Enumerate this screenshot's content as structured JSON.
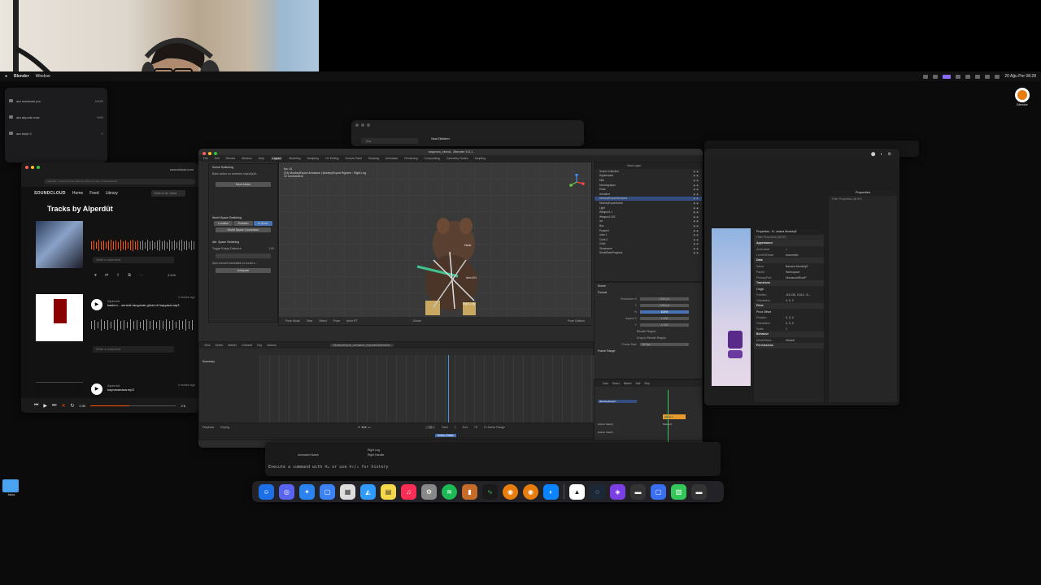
{
  "menubar": {
    "app": "Blender",
    "items": [
      "Window"
    ],
    "clock": "20 Ağu Per 08:28"
  },
  "bluetooth": {
    "devices": [
      {
        "name": "ara macbook pro",
        "status": "N/OR"
      },
      {
        "name": "ara airpods max",
        "status": "%90"
      },
      {
        "name": "ara keyb 0",
        "status": "*/"
      }
    ]
  },
  "soundcloud": {
    "url": "soundcloud.com",
    "address": "Alperdüt – Listen to music albums online for free on SoundCloud",
    "brand": "SOUNDCLOUD",
    "nav": [
      "Home",
      "Feed",
      "Library"
    ],
    "search_placeholder": "Search for artist",
    "heading": "Tracks by Alperdüt",
    "comment_placeholder": "Write a comment",
    "tracks": [
      {
        "artist": "Alperdüt",
        "title": "kaskım... seninle tangımak güzel-di hopçakal.mp3",
        "ago": "4 months ago",
        "plays": "3,596"
      },
      {
        "artist": "Alperdüt",
        "title": "kaynananasa.mp3",
        "ago": "4 months ago",
        "plays": ""
      }
    ],
    "first_track": {
      "plays": "3,596"
    },
    "player_time": "0:39",
    "player_end": "2:5",
    "progress": 0.45
  },
  "finder": {
    "search_placeholder": "Ara",
    "window_title": "Sea Efektleri"
  },
  "blender": {
    "title": "maymon_blend - Blender 5.0.1",
    "menu": [
      "File",
      "Edit",
      "Render",
      "Window",
      "Help",
      "Layout",
      "Modeling",
      "Sculpting",
      "UV Editing",
      "Texture Paint",
      "Shading",
      "Animation",
      "Rendering",
      "Compositing",
      "Geometry Nodes",
      "Scripting"
    ],
    "tool_panel": {
      "header": "Scene Switching",
      "hint": "Bake action on selected object(s)/b",
      "save_button": "Save Action",
      "world_header": "World Space Switching",
      "world_tabs": [
        "Location",
        "Rotation",
        "to Bone"
      ],
      "world_button": "World Space Conversion",
      "attr_header": "Attr. Space Switching",
      "distance_label": "Toggle Empty Distance",
      "distance_value": "1.00",
      "checkbox_label": "Also convert translation to world s...",
      "bottom_button": "Autopose"
    },
    "viewport": {
      "fps": "fps: 41",
      "info": "(23) MonkeyExport Armature | MonkeyExport Rig/arm : Right Leg",
      "units": "10 Centimeters",
      "labels": [
        "Head",
        "Arm.001",
        "Right Leg"
      ]
    },
    "outliner": {
      "search": "View Layer",
      "rows": [
        "Scene Collection",
        "Hightmarine",
        "Milk",
        "Monkeyplayer",
        "Parts",
        "Armature",
        "MonkeyExport/Armature",
        "MonkeyExportAction",
        "Light",
        "Weapon1.1",
        "Weapon1.001",
        "Ice",
        "Box",
        "Pyramid",
        "cube.1",
        "Cube.2",
        "Cloth",
        "Glowscene",
        "WorldStateProgress"
      ]
    },
    "props": {
      "tab": "Scene",
      "section": "Format",
      "rows": [
        {
          "k": "Resolution X",
          "v": "1920 px"
        },
        {
          "k": "Y",
          "v": "1080 px"
        },
        {
          "k": "%",
          "v": "100%"
        },
        {
          "k": "Aspect X",
          "v": "1.000"
        },
        {
          "k": "Y",
          "v": "1.000"
        }
      ],
      "render_region": "Render Region",
      "crop": "Crop to Render Region",
      "frame_rate_label": "Frame Rate",
      "frame_rate": "60 fps",
      "frame_range": "Frame Range"
    },
    "dopesheet": {
      "mode": "Pose Mode",
      "menus": [
        "View",
        "Select",
        "Marker",
        "Channel",
        "Key",
        "Actions"
      ],
      "action": "MonkeyExport_Armature_ImportedAnimation",
      "summary": "Summary",
      "header_menus": [
        "View",
        "Select",
        "Pose",
        "Anim RT"
      ],
      "global": "Global",
      "options": "Pose Options"
    },
    "timeline": {
      "playback": "Playback",
      "keying": "Keying",
      "frame": "25",
      "start_label": "Start",
      "start": "1",
      "end_label": "End",
      "end": "75",
      "sync": "To Scene Range"
    },
    "nla": {
      "menus": [
        "View",
        "Select",
        "Marker",
        "Add",
        "Strip"
      ],
      "tracks": [
        "[MonkeyExport...",
        "[Action Stash]",
        "[Action Stash]"
      ],
      "strip": "Action 1",
      "strip2": "Scene A"
    },
    "status": "Action Editor"
  },
  "props_window": {
    "title": "Properties",
    "filter": "Filter Properties (⌘ BF)",
    "inspector_title": "Properties - N...anana MonkeyE",
    "appearance": "Appearance",
    "rows_a": [
      {
        "k": "Archivable",
        "v": "✓"
      },
      {
        "k": "LevelOfDetail",
        "v": "Automatic"
      }
    ],
    "data": "Data",
    "rows_b": [
      {
        "k": "Name",
        "v": "Banana MonkeyE"
      },
      {
        "k": "Parent",
        "v": "Workspace"
      },
      {
        "k": "PrimaryPart",
        "v": "HumanoidRootP"
      }
    ],
    "transform": "Transform",
    "origin": "Origin",
    "rows_c": [
      {
        "k": "Position",
        "v": "-83.145, 3.014, -5..."
      },
      {
        "k": "Orientation",
        "v": "0, 0, 0"
      }
    ],
    "pivot": "Pivot",
    "pivot_offset": "Pivot Offset",
    "rows_d": [
      {
        "k": "Position",
        "v": "0, 0, 0"
      },
      {
        "k": "Orientation",
        "v": "0, 0, 0"
      },
      {
        "k": "Scale",
        "v": "1"
      }
    ],
    "behavior": "Behavior",
    "rows_e": [
      {
        "k": "ModelStrea...",
        "v": "Default"
      }
    ],
    "permissions": "Permissions"
  },
  "terminal": {
    "line": "Execute a command with ⌘↵ or use ⌘↑/↓ for history",
    "tab1": "Animation Name",
    "tab2": "Right Leg",
    "tab3": "Right Handle"
  },
  "desktop": {
    "folder_label": "fotos",
    "drive_label": "Blender"
  },
  "colors": {
    "soundcloud_orange": "#ff5500",
    "blender_blue": "#4772b3",
    "nla_orange": "#e49a2c"
  }
}
